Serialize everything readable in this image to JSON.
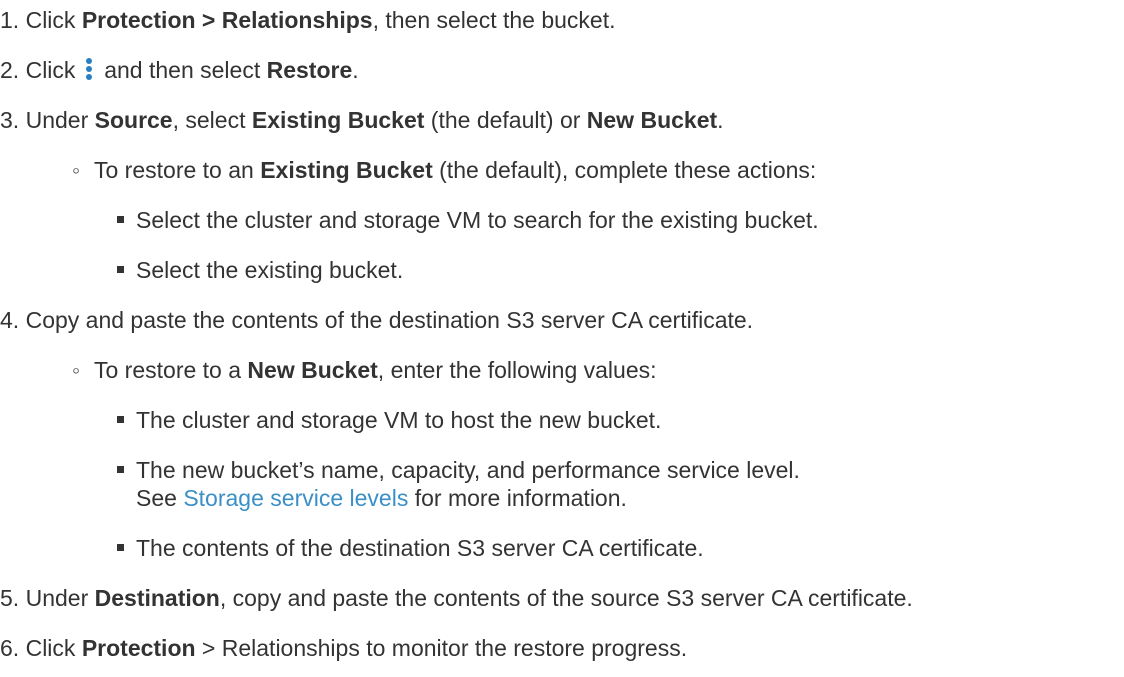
{
  "steps": [
    {
      "num": "1.",
      "t1": "Click ",
      "b1": "Protection > Relationships",
      "t2": ", then select the bucket."
    },
    {
      "num": "2.",
      "t1": "Click",
      "t2": " and then select ",
      "b1": "Restore",
      "t3": "."
    },
    {
      "num": "3.",
      "t1": "Under ",
      "b1": "Source",
      "t2": ", select ",
      "b2": "Existing Bucket",
      "t3": " (the default) or ",
      "b3": "New Bucket",
      "t4": "."
    },
    {
      "num": "4.",
      "t1": "Copy and paste the contents of the destination S3 server CA certificate."
    },
    {
      "num": "5.",
      "t1": "Under ",
      "b1": "Destination",
      "t2": ", copy and paste the contents of the source S3 server CA certificate."
    },
    {
      "num": "6.",
      "t1": "Click ",
      "b1": "Protection",
      "t2": " > Relationships to monitor the restore progress."
    }
  ],
  "existing": {
    "bullet": "◦",
    "t1": "To restore to an ",
    "b1": "Existing Bucket",
    "t2": " (the default), complete these actions:",
    "items": [
      "Select the cluster and storage VM to search for the existing bucket.",
      "Select the existing bucket."
    ]
  },
  "newbucket": {
    "bullet": "◦",
    "t1": "To restore to a ",
    "b1": "New Bucket",
    "t2": ", enter the following values:",
    "items": [
      "The cluster and storage VM to host the new bucket.",
      "The new bucket’s name, capacity, and performance service level.",
      "The contents of the destination S3 server CA certificate."
    ],
    "see_before": "See ",
    "link": "Storage service levels",
    "see_after": " for more information."
  }
}
